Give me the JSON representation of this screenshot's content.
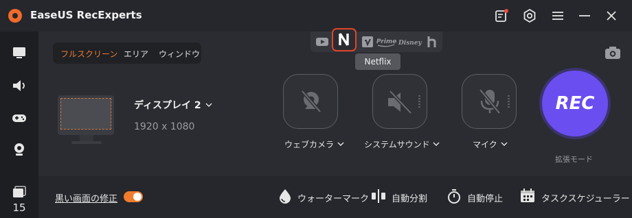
{
  "app": {
    "title": "EaseUS RecExperts"
  },
  "colors": {
    "accent": "#f07c2e",
    "rec": "#6b4ef0",
    "netflix_highlight": "#e0452b"
  },
  "titlebar": {
    "icons": [
      "notes-icon",
      "settings-icon",
      "menu-icon",
      "minimize-icon",
      "close-icon"
    ]
  },
  "sidebar": {
    "items": [
      {
        "icon": "screen-icon"
      },
      {
        "icon": "speaker-icon"
      },
      {
        "icon": "gamepad-icon"
      },
      {
        "icon": "webcam-icon"
      },
      {
        "icon": "recordings-icon"
      }
    ],
    "recordings_count": "15"
  },
  "mode_tabs": [
    {
      "label": "フルスクリーン",
      "active": true
    },
    {
      "label": "エリア",
      "active": false
    },
    {
      "label": "ウィンドウ",
      "active": false
    }
  ],
  "app_strip": {
    "apps": [
      "youtube-icon",
      "netflix-icon",
      "vimeo-icon",
      "prime-icon",
      "disney-icon",
      "hulu-icon"
    ],
    "prime_text": "Prime",
    "disney_text": "Disney",
    "selected": "netflix-icon",
    "tooltip": "Netflix"
  },
  "display": {
    "name": "ディスプレイ 2",
    "resolution": "1920 x 1080"
  },
  "sources": [
    {
      "label": "ウェブカメラ",
      "icon": "webcam-off-icon"
    },
    {
      "label": "システムサウンド",
      "icon": "speaker-off-icon"
    },
    {
      "label": "マイク",
      "icon": "mic-off-icon"
    }
  ],
  "rec": {
    "label": "REC",
    "mode": "拡張モード"
  },
  "bottom": {
    "fix_label": "黒い画面の修正",
    "fix_toggle_on": true,
    "tools": [
      {
        "label": "ウォーターマーク",
        "icon": "watermark-icon"
      },
      {
        "label": "自動分割",
        "icon": "split-icon"
      },
      {
        "label": "自動停止",
        "icon": "stopwatch-icon"
      },
      {
        "label": "タスクスケジューラー",
        "icon": "calendar-icon"
      }
    ]
  }
}
